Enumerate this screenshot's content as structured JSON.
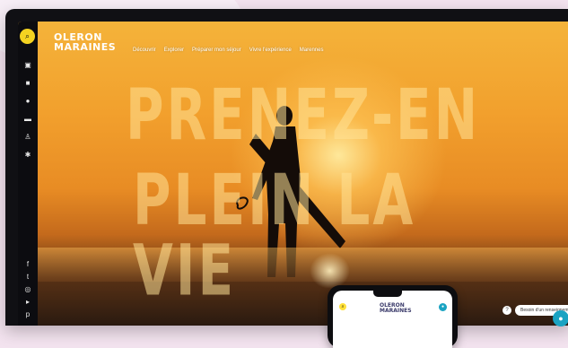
{
  "site": {
    "logo_line1": "OLERON",
    "logo_line2": "MARAINES"
  },
  "nav": {
    "items": [
      {
        "label": "Découvrir"
      },
      {
        "label": "Explorer"
      },
      {
        "label": "Préparer mon séjour"
      },
      {
        "label": "Vivre l'expérience"
      },
      {
        "label": "Marennes"
      }
    ]
  },
  "hero": {
    "line1": "PRENEZ-EN",
    "line2": "PLEIN LA VIE"
  },
  "help": {
    "label": "Besoin d'un renseignement ?",
    "icon": "help-circle-icon"
  },
  "chat": {
    "icon": "chat-bubble-icon"
  },
  "sidebar": {
    "icons": [
      "search-icon",
      "map-icon",
      "camera-icon",
      "pin-icon",
      "bed-icon",
      "walk-icon",
      "star-icon",
      "facebook-icon",
      "twitter-icon",
      "instagram-icon",
      "youtube-icon",
      "pinterest-icon"
    ]
  },
  "phone": {
    "logo_line1": "OLERON",
    "logo_line2": "MARAINES"
  },
  "colors": {
    "accent_yellow": "#f4d321",
    "chat_blue": "#1aa3c2",
    "sky_orange": "#f2a02d"
  }
}
